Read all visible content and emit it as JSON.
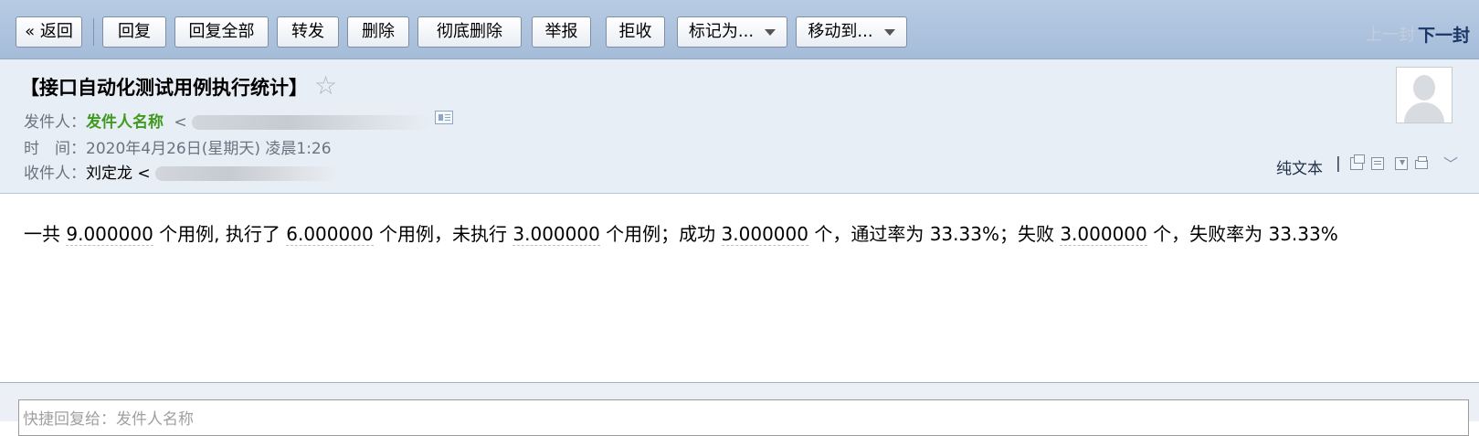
{
  "toolbar": {
    "back": "« 返回",
    "reply": "回复",
    "reply_all": "回复全部",
    "forward": "转发",
    "delete": "删除",
    "delete_permanently": "彻底删除",
    "report": "举报",
    "reject": "拒收",
    "mark_as": "标记为...",
    "move_to": "移动到...",
    "prev": "上一封",
    "next": "下一封"
  },
  "email": {
    "subject": "【接口自动化测试用例执行统计】",
    "star_icon": "☆",
    "sender_label": "发件人：",
    "sender_name": "发件人名称",
    "addr_open": "<",
    "time_label": "时　间：",
    "time_value": "2020年4月26日(星期天) 凌晨1:26",
    "recipient_label": "收件人：",
    "recipient_name": "刘定龙",
    "plain_text": "纯文本",
    "divider": "|",
    "expand_icon": "﹀"
  },
  "body": {
    "seg1": "一共 ",
    "total": "9.000000",
    "seg2": " 个用例, 执行了 ",
    "executed": "6.000000",
    "seg3": " 个用例，未执行 ",
    "not_executed": "3.000000",
    "seg4": " 个用例；成功 ",
    "success": "3.000000",
    "seg5": " 个，通过率为 33.33%；失败 ",
    "failed": "3.000000",
    "seg6": " 个，失败率为 33.33%"
  },
  "quick_reply": {
    "placeholder": "快捷回复给：发件人名称"
  },
  "colors": {
    "toolbar_bg": "#b7cbe3",
    "header_bg": "#e8eef6",
    "sender_name": "#3f9a1e",
    "next_link": "#1a3666"
  }
}
